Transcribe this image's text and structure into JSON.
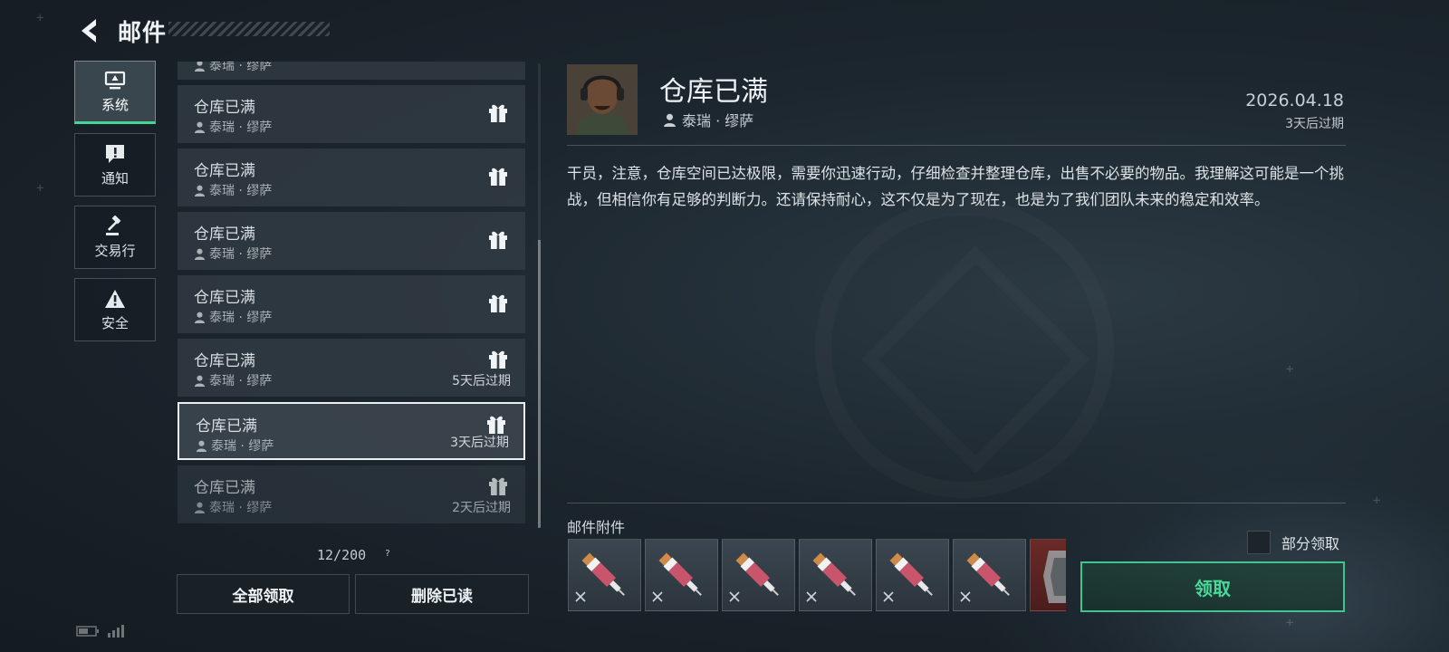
{
  "header": {
    "title": "邮件",
    "back_icon": "chevron-left-icon"
  },
  "tabs": [
    {
      "label": "系统",
      "icon": "monitor-icon",
      "active": true
    },
    {
      "label": "通知",
      "icon": "alert-message-icon",
      "active": false
    },
    {
      "label": "交易行",
      "icon": "gavel-icon",
      "active": false
    },
    {
      "label": "安全",
      "icon": "warning-triangle-icon",
      "active": false
    }
  ],
  "mail_list": {
    "partial_top": {
      "sender": "泰瑞 · 缪萨"
    },
    "items": [
      {
        "subject": "仓库已满",
        "sender": "泰瑞 · 缪萨",
        "gift": true,
        "expire": ""
      },
      {
        "subject": "仓库已满",
        "sender": "泰瑞 · 缪萨",
        "gift": true,
        "expire": ""
      },
      {
        "subject": "仓库已满",
        "sender": "泰瑞 · 缪萨",
        "gift": true,
        "expire": ""
      },
      {
        "subject": "仓库已满",
        "sender": "泰瑞 · 缪萨",
        "gift": true,
        "expire": ""
      },
      {
        "subject": "仓库已满",
        "sender": "泰瑞 · 缪萨",
        "gift": true,
        "expire": "5天后过期"
      },
      {
        "subject": "仓库已满",
        "sender": "泰瑞 · 缪萨",
        "gift": true,
        "expire": "3天后过期",
        "selected": true
      },
      {
        "subject": "仓库已满",
        "sender": "泰瑞 · 缪萨",
        "gift": true,
        "expire": "2天后过期",
        "faded": true
      }
    ],
    "count": "12/200",
    "help_icon": "?",
    "claim_all_label": "全部领取",
    "delete_read_label": "删除已读"
  },
  "detail": {
    "subject": "仓库已满",
    "sender": "泰瑞 · 缪萨",
    "date": "2026.04.18",
    "expire": "3天后过期",
    "body": "干员，注意，仓库空间已达极限，需要你迅速行动，仔细检查并整理仓库，出售不必要的物品。我理解这可能是一个挑战，但相信你有足够的判断力。还请保持耐心，这不仅是为了现在，也是为了我们团队未来的稳定和效率。",
    "attachments_label": "邮件附件",
    "attachments": [
      "syringe-item-icon",
      "syringe-item-icon",
      "syringe-item-icon",
      "syringe-item-icon",
      "syringe-item-icon",
      "syringe-item-icon",
      "armor-item-icon"
    ],
    "partial_claim_label": "部分领取",
    "claim_label": "领取"
  },
  "colors": {
    "accent_green": "#47d49a",
    "background": "#1c262e",
    "attachment_red": "#6b2a28"
  }
}
